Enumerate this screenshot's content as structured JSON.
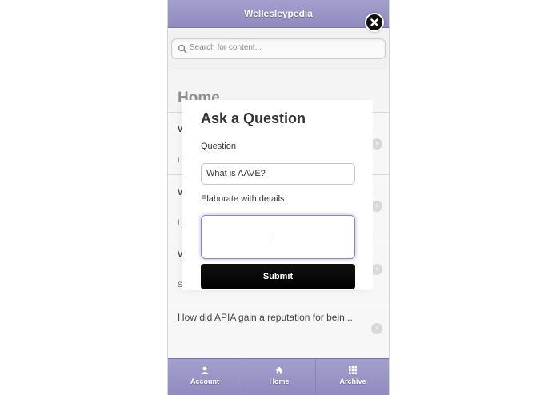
{
  "app": {
    "title": "Wellesleypedia"
  },
  "search": {
    "placeholder": "Search for content..."
  },
  "home": {
    "heading": "Home"
  },
  "list": {
    "items": [
      {
        "first": "W",
        "second": "I c"
      },
      {
        "first": "W",
        "second": "I h"
      },
      {
        "first": "W",
        "second": "Sc"
      }
    ],
    "bottom_question": "How did APIA gain a reputation for bein..."
  },
  "modal": {
    "title": "Ask a Question",
    "question_label": "Question",
    "question_value": "What is AAVE?",
    "details_label": "Elaborate with details",
    "details_value": "",
    "submit_label": "Submit"
  },
  "nav": [
    {
      "label": "Account",
      "icon": "person-icon"
    },
    {
      "label": "Home",
      "icon": "home-icon"
    },
    {
      "label": "Archive",
      "icon": "grid-icon"
    }
  ],
  "colors": {
    "bar": "#9793c6",
    "accent_focus": "#8a86c0",
    "submit": "#000000"
  }
}
